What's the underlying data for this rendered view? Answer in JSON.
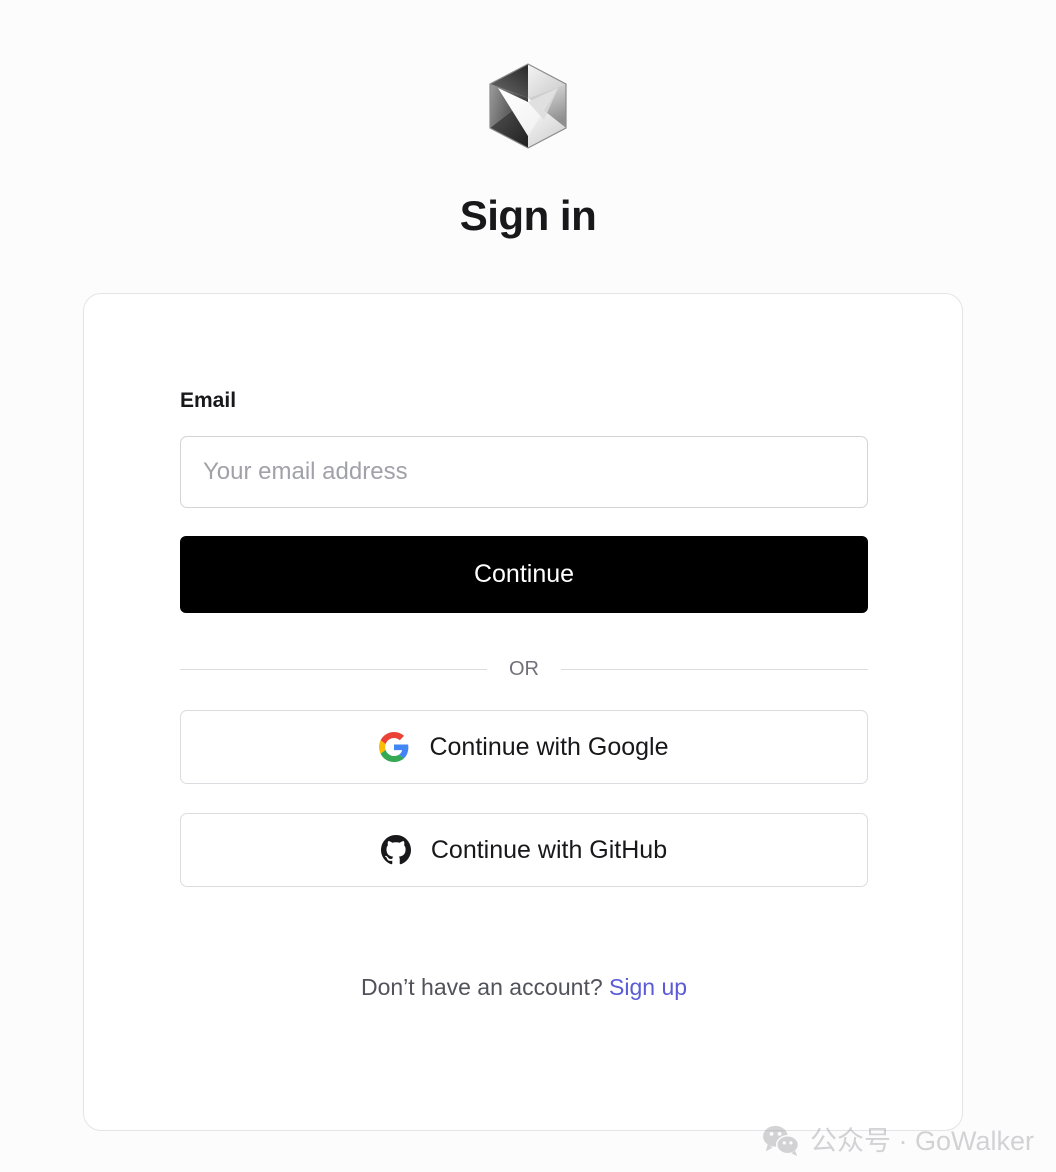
{
  "page": {
    "background_color": "#fcfcfc",
    "title": "Sign in"
  },
  "logo": {
    "icon_name": "cube-logo-icon",
    "description": "grayscale folded hexagonal cube"
  },
  "form": {
    "email": {
      "label": "Email",
      "placeholder": "Your email address",
      "value": ""
    },
    "continue_button": {
      "label": "Continue",
      "background_color": "#000000",
      "text_color": "#ffffff"
    }
  },
  "divider": {
    "label": "OR"
  },
  "social": [
    {
      "label": "Continue with Google",
      "icon_name": "google-icon"
    },
    {
      "label": "Continue with GitHub",
      "icon_name": "github-icon"
    }
  ],
  "footer": {
    "prompt": "Don’t have an account?",
    "link_label": "Sign up",
    "link_color": "#5b5bd6"
  },
  "watermark": {
    "icon_name": "wechat-icon",
    "text": "公众号 · GoWalker"
  }
}
